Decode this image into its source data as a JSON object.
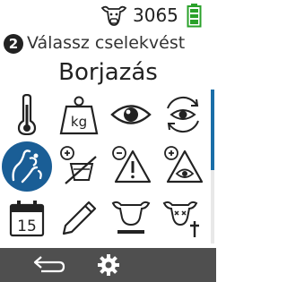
{
  "status": {
    "animal_icon": "cow-head-icon",
    "animal_count": "3065",
    "battery_icon": "battery-full-icon",
    "battery_color": "#2aa12a"
  },
  "header": {
    "step_number": "2",
    "title": "Válassz cselekvést",
    "subtitle": "Borjazás"
  },
  "actions": [
    {
      "icon": "thermometer-icon",
      "label": ""
    },
    {
      "icon": "weight-kg-icon",
      "label": "kg"
    },
    {
      "icon": "eye-icon",
      "label": ""
    },
    {
      "icon": "eye-recheck-icon",
      "label": ""
    },
    {
      "icon": "calving-icon",
      "label": "",
      "selected": true
    },
    {
      "icon": "milk-no-icon",
      "label": ""
    },
    {
      "icon": "warning-icon",
      "label": ""
    },
    {
      "icon": "eye-plus-icon",
      "label": ""
    },
    {
      "icon": "calendar-icon",
      "label": "15"
    },
    {
      "icon": "pencil-icon",
      "label": ""
    },
    {
      "icon": "cow-remove-icon",
      "label": ""
    },
    {
      "icon": "cow-dead-icon",
      "label": ""
    }
  ],
  "colors": {
    "accent": "#1a5e96",
    "bottom_bar": "#4f4f4f"
  },
  "bottom": {
    "back_icon": "back-arrow-icon",
    "settings_icon": "gear-icon"
  }
}
